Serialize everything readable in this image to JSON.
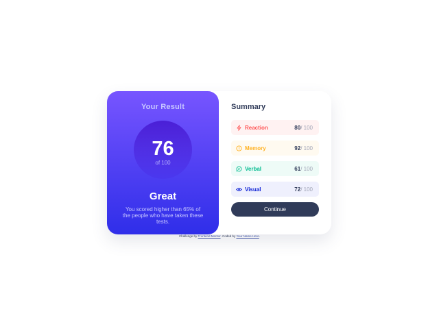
{
  "result": {
    "title": "Your Result",
    "score": "76",
    "score_of": "of 100",
    "rating": "Great",
    "description": "You scored higher than 65% of the people who have taken these tests."
  },
  "summary": {
    "title": "Summary",
    "items": [
      {
        "label": "Reaction",
        "value": "80",
        "max": "/ 100",
        "icon": "lightning-icon",
        "color": "#ff5757"
      },
      {
        "label": "Memory",
        "value": "92",
        "max": "/ 100",
        "icon": "brain-icon",
        "color": "#ffb01f"
      },
      {
        "label": "Verbal",
        "value": "61",
        "max": "/ 100",
        "icon": "speech-bubble-icon",
        "color": "#00bb8f"
      },
      {
        "label": "Visual",
        "value": "72",
        "max": "/ 100",
        "icon": "eye-icon",
        "color": "#1125d6"
      }
    ],
    "continue_label": "Continue"
  },
  "attribution": {
    "prefix": "Challenge by ",
    "link1": "Frontend Mentor",
    "middle": ". Coded by ",
    "link2": "Your Name Here",
    "suffix": "."
  },
  "colors": {
    "gradient_top": "#7755ff",
    "gradient_bottom": "#2f2ee9",
    "button": "#303b59"
  }
}
